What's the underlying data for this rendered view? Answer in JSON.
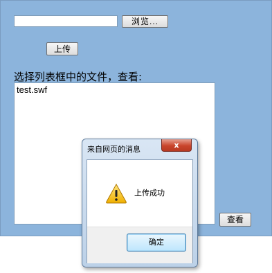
{
  "form": {
    "file_value": "",
    "browse_label": "浏览...",
    "upload_label": "上传",
    "instruction": "选择列表框中的文件，查看:",
    "files": [
      "test.swf"
    ],
    "view_label": "查看"
  },
  "dialog": {
    "title": "来自网页的消息",
    "close_label": "x",
    "icon": "warning-icon",
    "message": "上传成功",
    "ok_label": "确定"
  },
  "colors": {
    "page_background": "#8cb4dc",
    "close_button": "#c9452c"
  }
}
